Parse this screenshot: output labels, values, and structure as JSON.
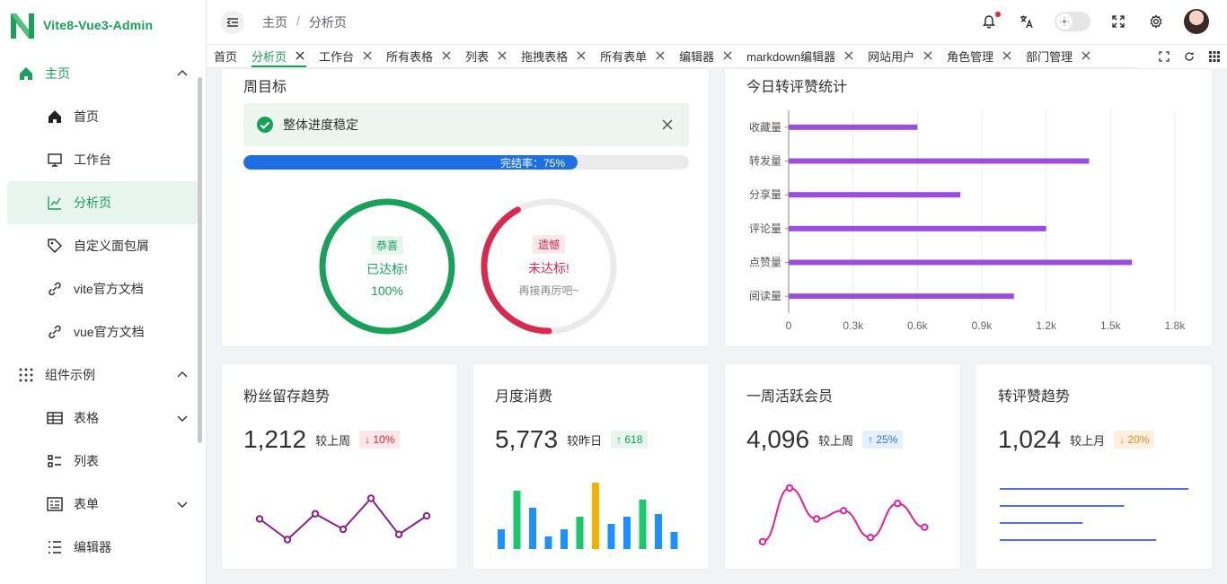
{
  "app": {
    "title": "Vite8-Vue3-Admin"
  },
  "sidebar": {
    "items": [
      {
        "label": "主页",
        "icon": "home-icon",
        "level": "top",
        "expanded": true
      },
      {
        "label": "首页",
        "icon": "house-icon",
        "level": "sub"
      },
      {
        "label": "工作台",
        "icon": "monitor-icon",
        "level": "sub"
      },
      {
        "label": "分析页",
        "icon": "line-chart-icon",
        "level": "sub",
        "active": true
      },
      {
        "label": "自定义面包屑",
        "icon": "tag-icon",
        "level": "sub"
      },
      {
        "label": "vite官方文档",
        "icon": "link-icon",
        "level": "sub"
      },
      {
        "label": "vue官方文档",
        "icon": "link-icon",
        "level": "sub"
      },
      {
        "label": "组件示例",
        "icon": "grid-icon",
        "level": "top",
        "expanded": true
      },
      {
        "label": "表格",
        "icon": "table-icon",
        "level": "sub",
        "expandable": true
      },
      {
        "label": "列表",
        "icon": "list-icon",
        "level": "sub"
      },
      {
        "label": "表单",
        "icon": "form-icon",
        "level": "sub",
        "expandable": true
      },
      {
        "label": "编辑器",
        "icon": "editor-icon",
        "level": "sub"
      }
    ]
  },
  "header": {
    "breadcrumb": [
      "主页",
      "分析页"
    ],
    "breadcrumb_sep": "/"
  },
  "tabs": [
    {
      "label": "首页",
      "closable": false
    },
    {
      "label": "分析页",
      "closable": true,
      "active": true
    },
    {
      "label": "工作台",
      "closable": true
    },
    {
      "label": "所有表格",
      "closable": true
    },
    {
      "label": "列表",
      "closable": true
    },
    {
      "label": "拖拽表格",
      "closable": true
    },
    {
      "label": "所有表单",
      "closable": true
    },
    {
      "label": "编辑器",
      "closable": true
    },
    {
      "label": "markdown编辑器",
      "closable": true
    },
    {
      "label": "网站用户",
      "closable": true
    },
    {
      "label": "角色管理",
      "closable": true
    },
    {
      "label": "部门管理",
      "closable": true
    }
  ],
  "weekly_goal": {
    "title": "周目标",
    "alert": "整体进度稳定",
    "progress_label": "完结率：75%",
    "progress": 0.75,
    "ring_success": {
      "tag": "恭喜",
      "line1": "已达标!",
      "line2": "100%",
      "value": 1.0
    },
    "ring_fail": {
      "tag": "遗憾",
      "line1": "未达标!",
      "line2": "再接再厉吧~",
      "value": 0.42
    }
  },
  "today_stats": {
    "title": "今日转评赞统计"
  },
  "chart_data": {
    "type": "bar",
    "orientation": "horizontal",
    "categories": [
      "收藏量",
      "转发量",
      "分享量",
      "评论量",
      "点赞量",
      "阅读量"
    ],
    "values": [
      600,
      1400,
      800,
      1200,
      1600,
      1050
    ],
    "xlim": [
      0,
      1800
    ],
    "ticks": [
      "0",
      "0.3k",
      "0.6k",
      "0.9k",
      "1.2k",
      "1.5k",
      "1.8k"
    ],
    "tick_values": [
      0,
      300,
      600,
      900,
      1200,
      1500,
      1800
    ],
    "color": "#9b4de0",
    "grid": true
  },
  "stats": [
    {
      "title": "粉丝留存趋势",
      "value": "1,212",
      "compare": "较上周",
      "delta": "↓ 10%",
      "badge": "red",
      "mini": {
        "type": "line",
        "values": [
          30,
          10,
          35,
          20,
          50,
          15,
          33
        ],
        "color": "#8b1e8b"
      }
    },
    {
      "title": "月度消费",
      "value": "5,773",
      "compare": "较昨日",
      "delta": "↑ 618",
      "badge": "green",
      "mini": {
        "type": "bar",
        "values": [
          22,
          65,
          46,
          14,
          22,
          36,
          74,
          28,
          36,
          55,
          39,
          19
        ],
        "colors": [
          "#1e90ff",
          "#19c86a",
          "#1e90ff",
          "#1e90ff",
          "#1e90ff",
          "#19c86a",
          "#f5b000",
          "#1e90ff",
          "#1e90ff",
          "#19c86a",
          "#1e90ff",
          "#1e90ff"
        ]
      }
    },
    {
      "title": "一周活跃会员",
      "value": "4,096",
      "compare": "较上周",
      "delta": "↑ 25%",
      "badge": "blue",
      "mini": {
        "type": "smooth",
        "values": [
          8,
          60,
          30,
          38,
          12,
          45,
          22
        ],
        "color": "#e61f9a"
      }
    },
    {
      "title": "转评赞趋势",
      "value": "1,024",
      "compare": "较上月",
      "delta": "↓ 20%",
      "badge": "orange",
      "mini": {
        "type": "hbars",
        "values": [
          100,
          66,
          44,
          83
        ],
        "color": "#5b6ee0"
      }
    }
  ]
}
